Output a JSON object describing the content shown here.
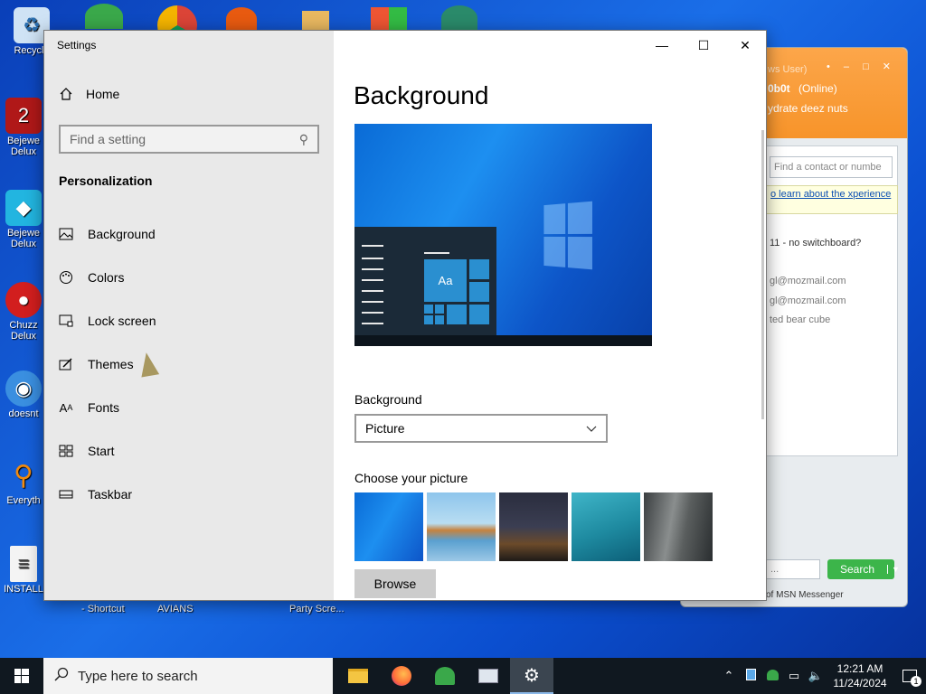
{
  "desktop": {
    "icons": [
      {
        "label": "Recycle",
        "icon": "recycle-bin-icon"
      },
      {
        "label": "Bejewe Delux",
        "icon": "bejeweled-2-icon"
      },
      {
        "label": "Bejewe Delux",
        "icon": "bejeweled-icon"
      },
      {
        "label": "Chuzz Delux",
        "icon": "chuzzle-icon"
      },
      {
        "label": "doesnt",
        "icon": "globe-icon"
      },
      {
        "label": "Everyth",
        "icon": "everything-search-icon"
      },
      {
        "label": "INSTALL",
        "icon": "document-icon"
      }
    ],
    "bottom_labels": [
      "- Shortcut",
      "AVIANS",
      "Party Scre..."
    ]
  },
  "msn": {
    "user_line": "ws User)",
    "status_name": "0b0t",
    "status": "(Online)",
    "message": "ydrate deez nuts",
    "find_placeholder": "Find a contact or numbe",
    "tip": "o learn about the xperience",
    "lines": [
      "11 - no switchboard?",
      "gl@mozmail.com",
      "gl@mozmail.com",
      "ted bear cube"
    ],
    "search_input": "...",
    "search_button": "Search",
    "footer": "of MSN Messenger"
  },
  "settings": {
    "window_title": "Settings",
    "home_label": "Home",
    "find_placeholder": "Find a setting",
    "section_title": "Personalization",
    "nav": [
      {
        "label": "Background",
        "icon": "image-icon"
      },
      {
        "label": "Colors",
        "icon": "palette-icon"
      },
      {
        "label": "Lock screen",
        "icon": "lock-screen-icon"
      },
      {
        "label": "Themes",
        "icon": "brush-icon"
      },
      {
        "label": "Fonts",
        "icon": "font-icon"
      },
      {
        "label": "Start",
        "icon": "start-tiles-icon"
      },
      {
        "label": "Taskbar",
        "icon": "taskbar-icon"
      }
    ],
    "page_title": "Background",
    "preview_tile": "Aa",
    "background_label": "Background",
    "background_value": "Picture",
    "choose_label": "Choose your picture",
    "browse_label": "Browse"
  },
  "taskbar": {
    "search_placeholder": "Type here to search",
    "time": "12:21 AM",
    "date": "11/24/2024",
    "notification_count": "1"
  }
}
